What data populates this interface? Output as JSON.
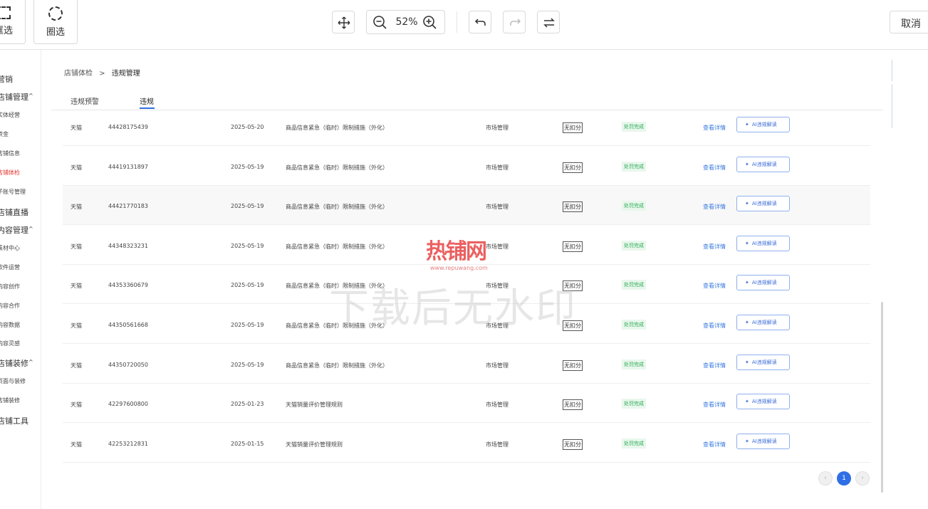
{
  "toolbar": {
    "rect_select_label": "框选",
    "lasso_select_label": "圈选",
    "zoom_value": "52%",
    "cancel_label": "取消"
  },
  "sidebar": {
    "items": [
      {
        "label": "营销",
        "kind": "head",
        "expanded": false
      },
      {
        "label": "店铺管理",
        "kind": "head",
        "expanded": true
      },
      {
        "label": "实体经营",
        "kind": "sub"
      },
      {
        "label": "资金",
        "kind": "sub"
      },
      {
        "label": "店铺信息",
        "kind": "sub"
      },
      {
        "label": "店铺体检",
        "kind": "sub",
        "active": true
      },
      {
        "label": "子账号管理",
        "kind": "sub"
      },
      {
        "label": "店铺直播",
        "kind": "head"
      },
      {
        "label": "内容管理",
        "kind": "head",
        "expanded": true
      },
      {
        "label": "素材中心",
        "kind": "sub"
      },
      {
        "label": "软件运营",
        "kind": "sub"
      },
      {
        "label": "内容创作",
        "kind": "sub"
      },
      {
        "label": "内容合作",
        "kind": "sub"
      },
      {
        "label": "内容数据",
        "kind": "sub"
      },
      {
        "label": "内容灵感",
        "kind": "sub"
      },
      {
        "label": "店铺装修",
        "kind": "head",
        "expanded": true
      },
      {
        "label": "页面与装修",
        "kind": "sub"
      },
      {
        "label": "店铺装修",
        "kind": "sub"
      },
      {
        "label": "店铺工具",
        "kind": "head"
      }
    ]
  },
  "breadcrumb": {
    "parent": "店铺体检",
    "sep": ">",
    "current": "违规管理"
  },
  "tabs": [
    {
      "label": "违规预警",
      "active": false
    },
    {
      "label": "违规",
      "active": true
    }
  ],
  "violations": [
    {
      "shop": "天猫",
      "id": "44428175439",
      "date": "2025-05-20",
      "rule": "商品信息紧急（临时）限制措施（外化）",
      "category": "市场管理",
      "points": "无扣分",
      "status": "处罚完成",
      "detail_link": "查看详情",
      "ai_button": "AI违规解读"
    },
    {
      "shop": "天猫",
      "id": "44419131897",
      "date": "2025-05-19",
      "rule": "商品信息紧急（临时）限制措施（外化）",
      "category": "市场管理",
      "points": "无扣分",
      "status": "处罚完成",
      "detail_link": "查看详情",
      "ai_button": "AI违规解读"
    },
    {
      "shop": "天猫",
      "id": "44421770183",
      "date": "2025-05-19",
      "rule": "商品信息紧急（临时）限制措施（外化）",
      "category": "市场管理",
      "points": "无扣分",
      "status": "处罚完成",
      "detail_link": "查看详情",
      "ai_button": "AI违规解读"
    },
    {
      "shop": "天猫",
      "id": "44348323231",
      "date": "2025-05-19",
      "rule": "商品信息紧急（临时）限制措施（外化）",
      "category": "市场管理",
      "points": "无扣分",
      "status": "处罚完成",
      "detail_link": "查看详情",
      "ai_button": "AI违规解读"
    },
    {
      "shop": "天猫",
      "id": "44353360679",
      "date": "2025-05-19",
      "rule": "商品信息紧急（临时）限制措施（外化）",
      "category": "市场管理",
      "points": "无扣分",
      "status": "处罚完成",
      "detail_link": "查看详情",
      "ai_button": "AI违规解读"
    },
    {
      "shop": "天猫",
      "id": "44350561668",
      "date": "2025-05-19",
      "rule": "商品信息紧急（临时）限制措施（外化）",
      "category": "市场管理",
      "points": "无扣分",
      "status": "处罚完成",
      "detail_link": "查看详情",
      "ai_button": "AI违规解读"
    },
    {
      "shop": "天猫",
      "id": "44350720050",
      "date": "2025-05-19",
      "rule": "商品信息紧急（临时）限制措施（外化）",
      "category": "市场管理",
      "points": "无扣分",
      "status": "处罚完成",
      "detail_link": "查看详情",
      "ai_button": "AI违规解读"
    },
    {
      "shop": "天猫",
      "id": "42297600800",
      "date": "2025-01-23",
      "rule": "天猫销量评价管理规则",
      "category": "市场管理",
      "points": "无扣分",
      "status": "处罚完成",
      "detail_link": "查看详情",
      "ai_button": "AI违规解读"
    },
    {
      "shop": "天猫",
      "id": "42253212831",
      "date": "2025-01-15",
      "rule": "天猫销量评价管理规则",
      "category": "市场管理",
      "points": "无扣分",
      "status": "处罚完成",
      "detail_link": "查看详情",
      "ai_button": "AI违规解读"
    }
  ],
  "pagination": {
    "current_page": "1",
    "prev_symbol": "‹",
    "next_symbol": "›"
  },
  "watermark": {
    "logo": "热铺网",
    "url": "www.repuwang.com",
    "text": "下载后无水印"
  },
  "colors": {
    "accent": "#2f6fe6",
    "link": "#3a7be0",
    "status_green": "#2bab55",
    "active_red": "#e6352f"
  }
}
